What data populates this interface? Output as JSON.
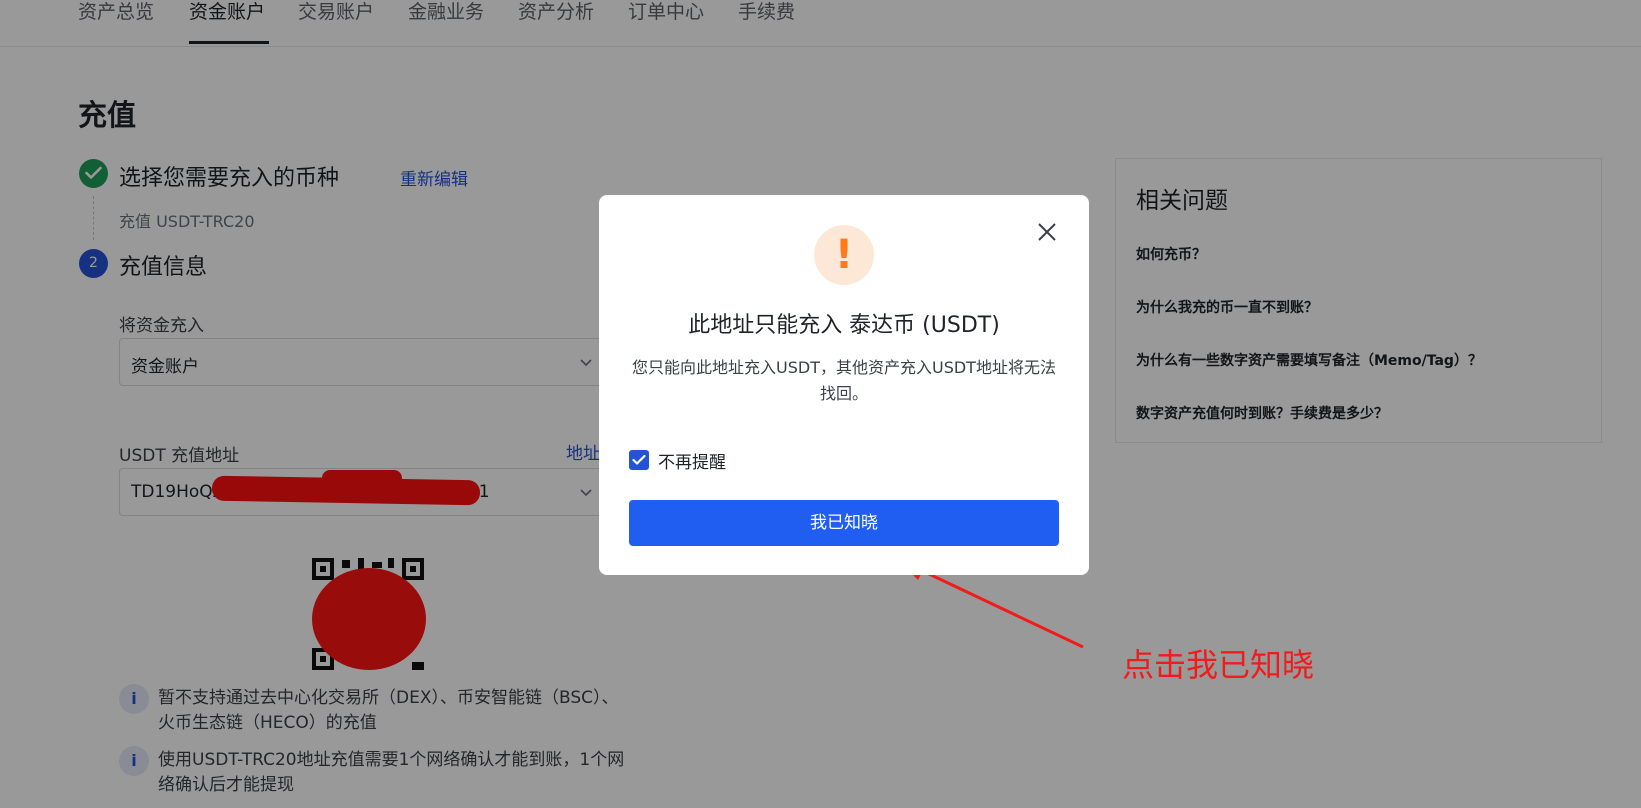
{
  "nav": {
    "items": [
      "资产总览",
      "资金账户",
      "交易账户",
      "金融业务",
      "资产分析",
      "订单中心",
      "手续费"
    ],
    "active_index": 1
  },
  "page": {
    "title": "充值"
  },
  "step1": {
    "title": "选择您需要充入的币种",
    "edit": "重新编辑",
    "summary": "充值 USDT-TRC20"
  },
  "step2": {
    "number": "2",
    "title": "充值信息"
  },
  "transfer_to": {
    "label": "将资金充入",
    "value": "资金账户"
  },
  "address": {
    "label": "USDT 充值地址",
    "link": "地址",
    "value_start": "TD19HoQZ",
    "value_end": "u1"
  },
  "notes": [
    "暂不支持通过去中心化交易所（DEX）、币安智能链（BSC）、火币生态链（HECO）的充值",
    "使用USDT-TRC20地址充值需要1个网络确认才能到账，1个网络确认后才能提现"
  ],
  "faq": {
    "title": "相关问题",
    "items": [
      "如何充币？",
      "为什么我充的币一直不到账？",
      "为什么有一些数字资产需要填写备注（Memo/Tag）？",
      "数字资产充值何时到账？手续费是多少？"
    ]
  },
  "modal": {
    "title": "此地址只能充入 泰达币 (USDT)",
    "description": "您只能向此地址充入USDT，其他资产充入USDT地址将无法找回。",
    "checkbox_label": "不再提醒",
    "checkbox_checked": true,
    "confirm": "我已知晓"
  },
  "annotation": {
    "text": "点击我已知晓"
  },
  "colors": {
    "primary": "#1f5ef0",
    "link": "#2453d6",
    "success": "#1e9e5a",
    "warning": "#ff7a1a",
    "annotation": "#f01c1c"
  }
}
